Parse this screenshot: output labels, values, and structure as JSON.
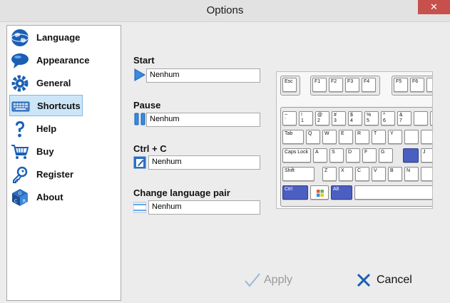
{
  "window": {
    "title": "Options",
    "close_symbol": "✕"
  },
  "sidebar": {
    "items": [
      {
        "label": "Language",
        "icon": "globe-icon"
      },
      {
        "label": "Appearance",
        "icon": "speech-bubble-icon"
      },
      {
        "label": "General",
        "icon": "gear-icon"
      },
      {
        "label": "Shortcuts",
        "icon": "keyboard-icon",
        "selected": true
      },
      {
        "label": "Help",
        "icon": "question-icon"
      },
      {
        "label": "Buy",
        "icon": "cart-icon"
      },
      {
        "label": "Register",
        "icon": "key-icon"
      },
      {
        "label": "About",
        "icon": "ocr-cube-icon"
      }
    ]
  },
  "shortcuts": [
    {
      "label": "Start",
      "value": "Nenhum",
      "icon": "play-icon"
    },
    {
      "label": "Pause",
      "value": "Nenhum",
      "icon": "pause-icon"
    },
    {
      "label": "Ctrl + C",
      "value": "Nenhum",
      "icon": "copy-edit-icon"
    },
    {
      "label": "Change language pair",
      "value": "Nenhum",
      "icon": "flag-icon"
    }
  ],
  "keyboard": {
    "rows": [
      [
        "Esc",
        "F1",
        "F2",
        "F3",
        "F4",
        "F5",
        "F6"
      ],
      [
        "~\n`",
        "!\n1",
        "@\n2",
        "#\n3",
        "$\n4",
        "%\n5",
        "^\n6",
        "&\n7"
      ],
      [
        "Tab",
        "Q",
        "W",
        "E",
        "R",
        "T",
        "Y"
      ],
      [
        "Caps Lock",
        "A",
        "S",
        "D",
        "F",
        "G",
        "",
        "J"
      ],
      [
        "Shift",
        "Z",
        "X",
        "C",
        "V",
        "B",
        "N"
      ],
      [
        "Ctrl",
        "",
        "Alt",
        ""
      ]
    ],
    "accent": "#4b5fc1"
  },
  "buttons": {
    "apply": "Apply",
    "cancel": "Cancel"
  },
  "colors": {
    "selection_bg": "#cce6f8",
    "selection_border": "#7fb8e0",
    "close_red": "#c7504d",
    "icon_blue": "#1a5fb4"
  }
}
